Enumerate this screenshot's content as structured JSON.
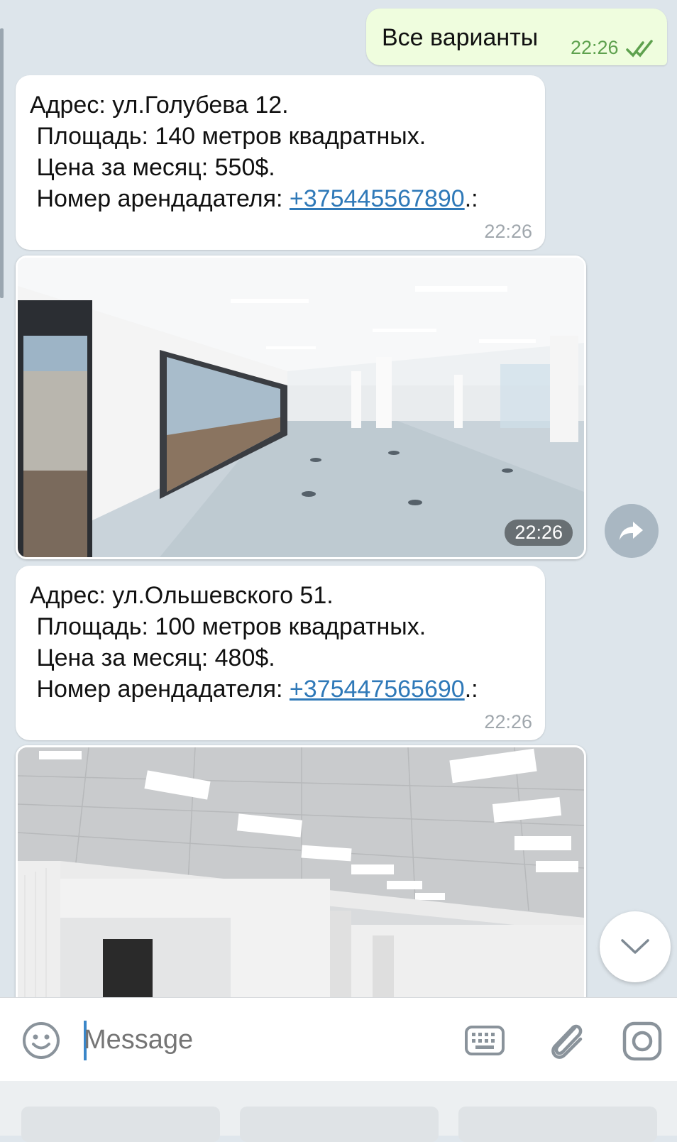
{
  "outgoing": {
    "text": "Все варианты",
    "time": "22:26"
  },
  "listings": [
    {
      "address": "Адрес: ул.Голубева 12.",
      "area": " Площадь: 140 метров квадратных.",
      "price": " Цена за месяц: 550$.",
      "owner_label": " Номер арендадателя: ",
      "phone": "+375445567890",
      "suffix": ".:",
      "time": "22:26",
      "photo_time": "22:26"
    },
    {
      "address": "Адрес: ул.Ольшевского 51.",
      "area": " Площадь: 100 метров квадратных.",
      "price": " Цена за месяц: 480$.",
      "owner_label": " Номер арендадателя: ",
      "phone": "+375447565690",
      "suffix": ".:",
      "time": "22:26"
    }
  ],
  "composer": {
    "placeholder": "Message"
  },
  "icons": {
    "emoji": "smile-icon",
    "keyboard": "keyboard-icon",
    "attach": "paperclip-icon",
    "camera": "camera-icon",
    "share": "share-arrow-icon",
    "scroll_down": "chevron-down-icon",
    "read_status": "double-check-icon"
  },
  "colors": {
    "chat_background": "#dde5eb",
    "outgoing_bubble": "#effdde",
    "link": "#2f79b8",
    "read_check": "#5ea14e"
  }
}
